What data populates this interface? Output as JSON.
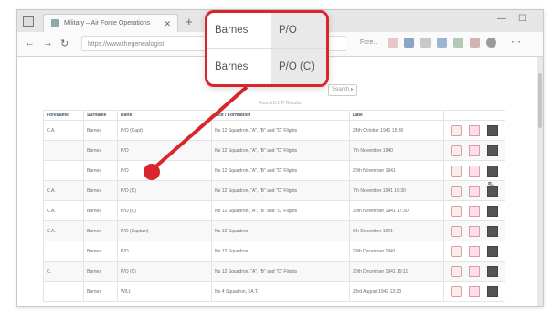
{
  "browser": {
    "tab_title": "Military – Air Force Operations",
    "url": "https://www.thegenealogist",
    "url_tail": "Fore..."
  },
  "search": {
    "button_label": "Search ▸"
  },
  "results_summary": "Found 8,177 Results",
  "table": {
    "columns": [
      "Forename",
      "Surname",
      "Rank",
      "Unit / Formation",
      "Date"
    ],
    "rows": [
      [
        "C.A.",
        "Barnes",
        "P/O (Capt)",
        "No 12 Squadron, \"A\", \"B\" and \"C\" Flights",
        "24th October 1941 15:30"
      ],
      [
        "",
        "Barnes",
        "P/O",
        "No 12 Squadron, \"A\", \"B\" and \"C\" Flights",
        "7th November 1940"
      ],
      [
        "",
        "Barnes",
        "P/O",
        "No 12 Squadron, \"A\", \"B\" and \"C\" Flights",
        "20th November 1941"
      ],
      [
        "C.A.",
        "Barnes",
        "P/O (C)",
        "No 12 Squadron, \"A\", \"B\" and \"C\" Flights",
        "7th November 1941 16:30"
      ],
      [
        "C.A.",
        "Barnes",
        "P/O (C)",
        "No 12 Squadron, \"A\", \"B\" and \"C\" Flights",
        "30th November 1941 17:30"
      ],
      [
        "C.A.",
        "Barnes",
        "P/O (Captain)",
        "No 12 Squadron",
        "6th December 1941"
      ],
      [
        "",
        "Barnes",
        "P/O",
        "No 12 Squadron",
        "29th December 1941"
      ],
      [
        "C.",
        "Barnes",
        "P/O (C)",
        "No 12 Squadron, \"A\", \"B\" and \"C\" Flights",
        "20th December 1941 19:11"
      ],
      [
        "",
        "Barnes",
        "W/Lt",
        "No 4 Squadron, I.A.T.",
        "23rd August 1942 12:20"
      ]
    ]
  },
  "callout": {
    "rows": [
      [
        "Barnes",
        "P/O"
      ],
      [
        "Barnes",
        "P/O (C)"
      ]
    ]
  },
  "colors": {
    "callout_border": "#d9262c",
    "leader_line": "#d9262c"
  },
  "icons": [
    "view-record-icon",
    "view-document-icon",
    "save-icon"
  ]
}
